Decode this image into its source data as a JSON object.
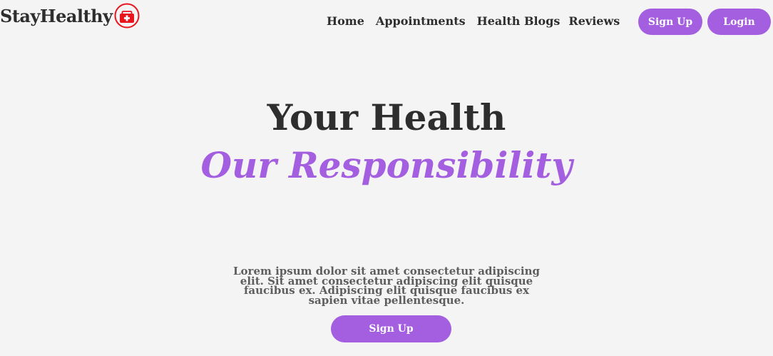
{
  "brand": {
    "name": "StayHealthy"
  },
  "nav": {
    "items": [
      {
        "label": "Home"
      },
      {
        "label": "Appointments"
      },
      {
        "label": "Health Blogs"
      },
      {
        "label": "Reviews"
      }
    ],
    "signup_label": "Sign Up",
    "login_label": "Login"
  },
  "hero": {
    "title": "Your Health",
    "subtitle": "Our Responsibility",
    "text": "Lorem ipsum dolor sit amet consectetur adipiscing elit. Sit amet consectetur adipiscing elit quisque faucibus ex. Adipiscing elit quisque faucibus ex sapien vitae pellentesque.",
    "cta_label": "Sign Up"
  },
  "colors": {
    "accent": "#a45ee0",
    "logo_red": "#e8151c",
    "text_dark": "#2e2e2e",
    "text_muted": "#5e5e5e",
    "background": "#f4f4f4"
  },
  "icons": {
    "logo": "medical-kit-icon"
  }
}
